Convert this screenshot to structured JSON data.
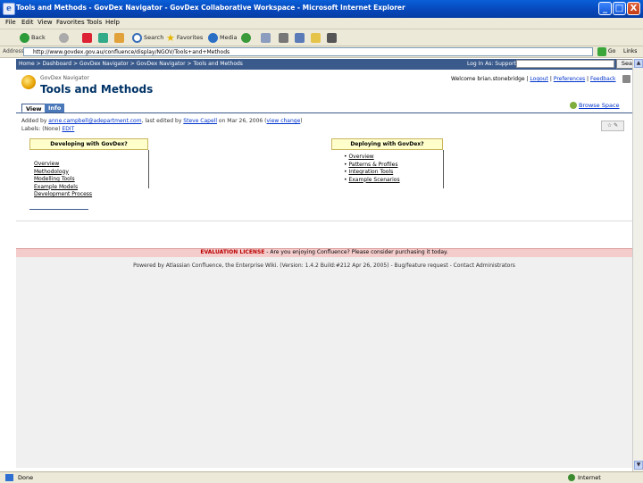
{
  "window": {
    "title": "Tools and Methods - GovDex Navigator - GovDex Collaborative Workspace - Microsoft Internet Explorer",
    "minimize": "_",
    "maximize": "□",
    "close": "X"
  },
  "menu": [
    "File",
    "Edit",
    "View",
    "Favorites",
    "Tools",
    "Help"
  ],
  "toolbar": {
    "back": "Back",
    "search": "Search",
    "favorites": "Favorites",
    "media": "Media"
  },
  "address": {
    "label": "Address",
    "url": "http://www.govdex.gov.au/confluence/display/NGOV/Tools+and+Methods",
    "go": "Go",
    "links": "Links"
  },
  "header": {
    "breadcrumbs": "Home > Dashboard > GovDex Navigator > GovDex Navigator > Tools and Methods",
    "login": "Log In As: Support",
    "search_button": "Search"
  },
  "page": {
    "space_name": "GovDex Navigator",
    "title": "Tools and Methods",
    "welcome": "Welcome brian.stonebridge | ",
    "logout": "Logout",
    "preferences": "Preferences",
    "feedback": "Feedback",
    "tab_view": "View",
    "tab_info": "Info",
    "browse_space": "Browse Space",
    "added_by_prefix": "Added by ",
    "added_by_user": "anne.campbell@adepartment.com",
    "added_by_mid": ", last edited by ",
    "edited_by_user": "Steve Capell",
    "edited_on": " on Mar 26, 2006 (",
    "view_change": "view change",
    "edited_suffix": ")",
    "labels_prefix": "Labels: (None) ",
    "labels_edit": "EDIT",
    "page_icons": "☆ ✎"
  },
  "left_panel": {
    "heading": "Developing with GovDex?",
    "items": [
      "Overview",
      "Methodology",
      "Modelling Tools",
      "Example Models",
      "Development Process"
    ]
  },
  "right_panel": {
    "heading": "Deploying with GovDex?",
    "items": [
      "Overview",
      "Patterns & Profiles",
      "Integration Tools",
      "Example Scenarios"
    ]
  },
  "eval": {
    "label": "EVALUATION LICENSE",
    "message": " - Are you enjoying Confluence? Please consider purchasing it today."
  },
  "footer": "Powered by Atlassian Confluence, the Enterprise Wiki. (Version: 1.4.2 Build:#212 Apr 26, 2005) - Bug/feature request - Contact Administrators",
  "status": {
    "text": "Done",
    "zone": "Internet"
  }
}
